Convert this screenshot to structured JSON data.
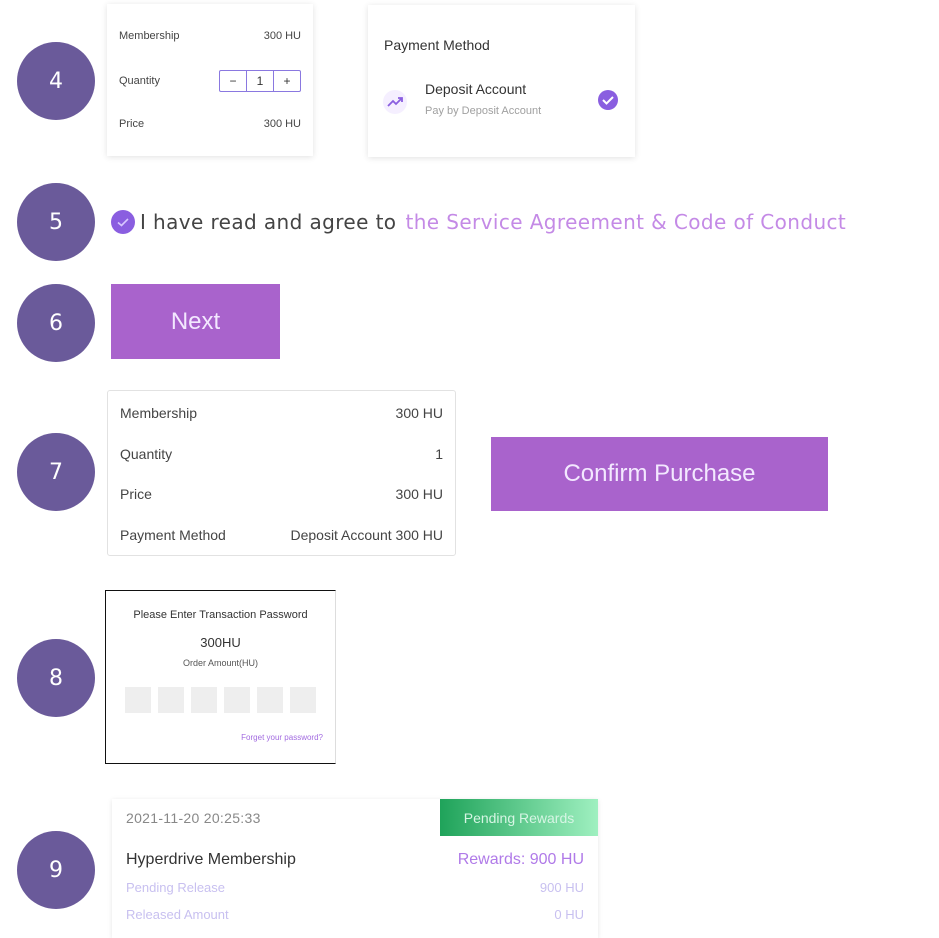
{
  "steps": [
    "4",
    "5",
    "6",
    "7",
    "8",
    "9"
  ],
  "step4": {
    "order": {
      "membership_label": "Membership",
      "membership_value": "300 HU",
      "quantity_label": "Quantity",
      "quantity_minus": "−",
      "quantity_value": "1",
      "quantity_plus": "+",
      "price_label": "Price",
      "price_value": "300 HU"
    },
    "payment": {
      "title": "Payment Method",
      "option_name": "Deposit Account",
      "option_desc": "Pay by Deposit Account",
      "icon": "trend-up-icon",
      "check_icon": "check-circle-icon",
      "selected": true
    }
  },
  "step5": {
    "agree_text": "I have read and agree to",
    "agreement_link": "the Service Agreement & Code of Conduct",
    "checked": true
  },
  "step6": {
    "next_label": "Next"
  },
  "step7": {
    "rows": [
      {
        "label": "Membership",
        "value": "300 HU"
      },
      {
        "label": "Quantity",
        "value": "1"
      },
      {
        "label": "Price",
        "value": "300 HU"
      },
      {
        "label": "Payment Method",
        "value": "Deposit Account 300 HU"
      }
    ],
    "confirm_label": "Confirm Purchase"
  },
  "step8": {
    "title": "Please Enter Transaction Password",
    "amount": "300HU",
    "amount_label": "Order Amount(HU)",
    "forgot_link": "Forget your password?",
    "digit_count": 6
  },
  "step9": {
    "timestamp": "2021-11-20 20:25:33",
    "status": "Pending Rewards",
    "product": "Hyperdrive Membership",
    "rewards": "Rewards: 900 HU",
    "pending_label": "Pending Release",
    "pending_value": "900 HU",
    "released_label": "Released Amount",
    "released_value": "0 HU"
  },
  "colors": {
    "step_circle": "#6a5a9a",
    "accent_purple": "#a963cc",
    "link_purple": "#c48ae6",
    "check_purple": "#8a5ee0",
    "pending_green_start": "#1fa35a",
    "pending_green_end": "#9ff0c0"
  }
}
